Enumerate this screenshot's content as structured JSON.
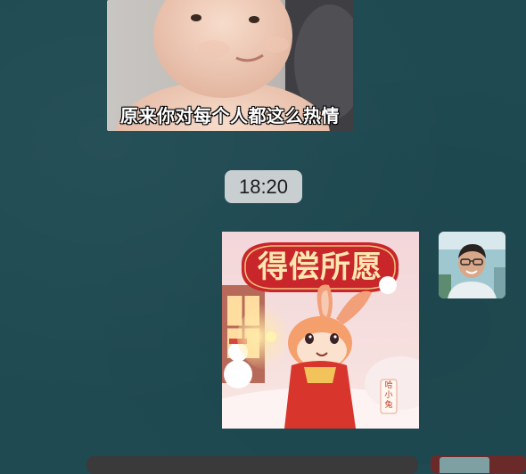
{
  "messages": {
    "received_sticker": {
      "caption": "原来你对每个人都这么热情"
    },
    "timestamp": "18:20",
    "sent_sticker": {
      "title": "得偿所愿",
      "sign": "哈小兔"
    }
  }
}
